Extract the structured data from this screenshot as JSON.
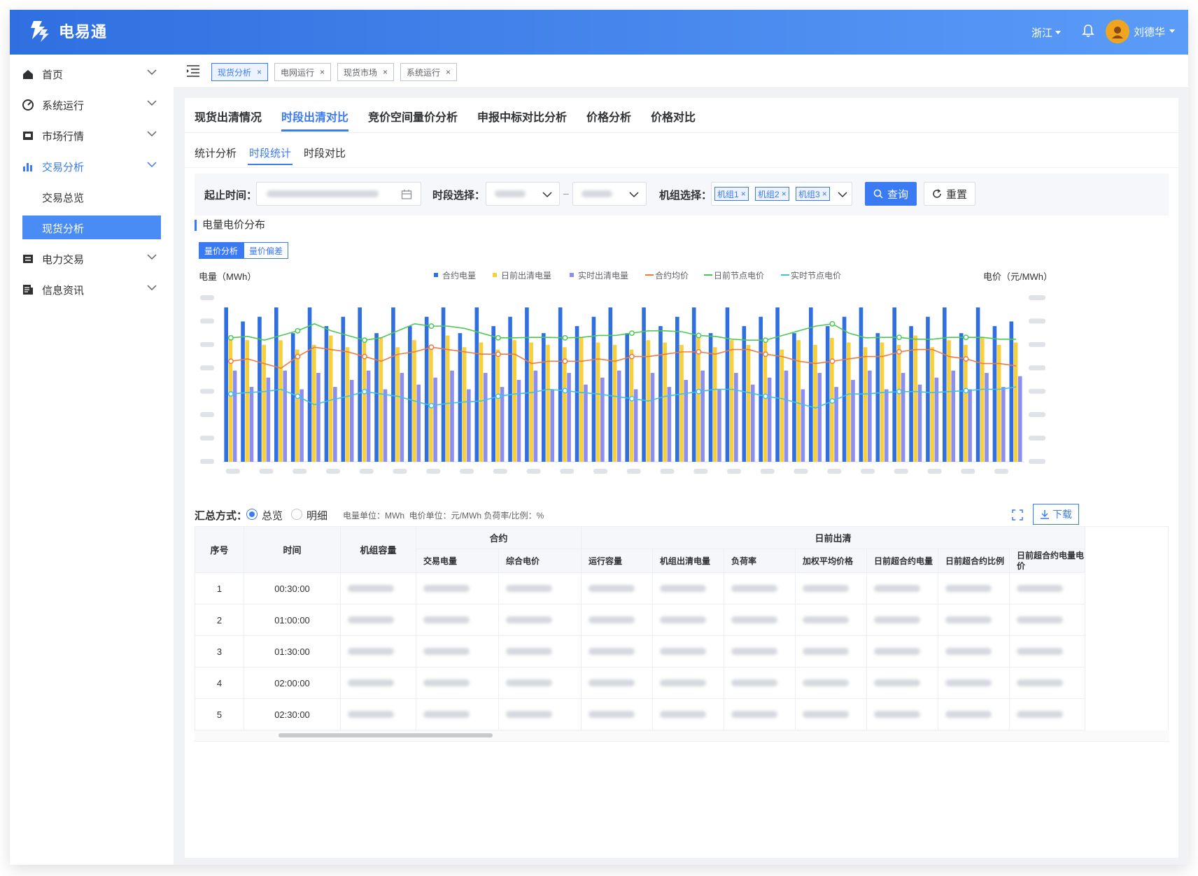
{
  "app": {
    "name": "电易通",
    "region": "浙江",
    "user": "刘德华"
  },
  "sidebar": {
    "items": [
      {
        "label": "首页",
        "icon": "home-icon"
      },
      {
        "label": "系统运行",
        "icon": "dashboard-icon"
      },
      {
        "label": "市场行情",
        "icon": "market-icon"
      },
      {
        "label": "交易分析",
        "icon": "bar-chart-icon"
      },
      {
        "label": "电力交易",
        "icon": "trade-icon"
      },
      {
        "label": "信息资讯",
        "icon": "news-icon"
      }
    ],
    "subitems": [
      {
        "label": "交易总览"
      },
      {
        "label": "现货分析"
      }
    ]
  },
  "tags": [
    {
      "label": "现货分析"
    },
    {
      "label": "电网运行"
    },
    {
      "label": "现货市场"
    },
    {
      "label": "系统运行"
    }
  ],
  "tabs": [
    {
      "label": "现货出清情况"
    },
    {
      "label": "时段出清对比"
    },
    {
      "label": "竞价空间量价分析"
    },
    {
      "label": "申报中标对比分析"
    },
    {
      "label": "价格分析"
    },
    {
      "label": "价格对比"
    }
  ],
  "subtabs": [
    {
      "label": "统计分析"
    },
    {
      "label": "时段统计"
    },
    {
      "label": "时段对比"
    }
  ],
  "filter": {
    "date_label": "起止时间：",
    "period_label": "时段选择：",
    "period_sep": "–",
    "unit_label": "机组选择：",
    "units": [
      "机组1",
      "机组2",
      "机组3"
    ],
    "query_label": "查询",
    "reset_label": "重置"
  },
  "chart_title": "电量电价分布",
  "segments": [
    {
      "label": "量价分析"
    },
    {
      "label": "量价偏差"
    }
  ],
  "chart_data": {
    "type": "bar",
    "ylabel": "电量（MWh）",
    "y2label": "电价（元/MWh）",
    "legend_position": "top",
    "grid": false,
    "series": [
      {
        "name": "合约电量",
        "kind": "bar",
        "color": "#2f6fe0",
        "values": [
          330,
          300,
          310,
          330,
          275,
          330,
          290,
          310,
          330,
          275,
          330,
          290,
          310,
          330,
          275,
          330,
          290,
          310,
          330,
          275,
          330,
          290,
          310,
          330,
          275,
          330,
          290,
          310,
          330,
          275,
          330,
          290,
          310,
          330,
          275,
          330,
          290,
          310,
          330,
          275,
          330,
          290,
          310,
          330,
          275,
          330,
          290,
          300
        ]
      },
      {
        "name": "日前出清电量",
        "kind": "bar",
        "color": "#f7d03c",
        "values": [
          270,
          260,
          250,
          260,
          240,
          250,
          270,
          245,
          255,
          265,
          245,
          260,
          250,
          270,
          245,
          255,
          240,
          260,
          255,
          250,
          245,
          265,
          255,
          250,
          240,
          260,
          255,
          250,
          270,
          245,
          260,
          250,
          255,
          240,
          260,
          250,
          265,
          255,
          245,
          255,
          250,
          270,
          245,
          260,
          250,
          265,
          250,
          255
        ]
      },
      {
        "name": "实时出清电量",
        "kind": "bar",
        "color": "#8d8ff0",
        "values": [
          195,
          160,
          180,
          195,
          155,
          190,
          160,
          175,
          195,
          155,
          190,
          165,
          180,
          195,
          155,
          190,
          160,
          175,
          195,
          155,
          190,
          165,
          180,
          195,
          155,
          190,
          160,
          175,
          195,
          155,
          190,
          165,
          180,
          195,
          155,
          190,
          160,
          175,
          195,
          155,
          190,
          165,
          180,
          195,
          155,
          190,
          160,
          183
        ]
      },
      {
        "name": "合约均价",
        "kind": "line",
        "color": "#f07b3f",
        "values": [
          215,
          220,
          210,
          200,
          225,
          245,
          240,
          235,
          225,
          215,
          230,
          235,
          245,
          240,
          235,
          230,
          230,
          230,
          210,
          215,
          215,
          215,
          220,
          215,
          225,
          225,
          230,
          235,
          235,
          230,
          240,
          240,
          230,
          225,
          215,
          210,
          215,
          220,
          225,
          225,
          235,
          240,
          240,
          225,
          220,
          210,
          210,
          205
        ]
      },
      {
        "name": "日前节点电价",
        "kind": "line",
        "color": "#4cc954",
        "values": [
          265,
          268,
          260,
          270,
          280,
          295,
          280,
          270,
          260,
          265,
          280,
          295,
          290,
          290,
          285,
          275,
          265,
          265,
          266,
          266,
          265,
          266,
          270,
          270,
          275,
          280,
          280,
          278,
          270,
          268,
          262,
          260,
          260,
          270,
          280,
          290,
          295,
          275,
          265,
          266,
          266,
          262,
          262,
          266,
          266,
          266,
          262,
          262
        ]
      },
      {
        "name": "实时节点电价",
        "kind": "line",
        "color": "#3fc1e0",
        "values": [
          145,
          148,
          150,
          155,
          140,
          122,
          132,
          140,
          150,
          145,
          140,
          130,
          120,
          125,
          128,
          130,
          140,
          145,
          148,
          155,
          152,
          148,
          145,
          140,
          135,
          130,
          140,
          145,
          150,
          155,
          155,
          148,
          140,
          135,
          125,
          115,
          130,
          145,
          145,
          148,
          150,
          150,
          148,
          150,
          152,
          155,
          155,
          160
        ]
      }
    ],
    "ylim": [
      0,
      350
    ],
    "y2lim": [
      0,
      350
    ]
  },
  "summary": {
    "label": "汇总方式：",
    "opt1": "总览",
    "opt2": "明细",
    "units": "电量单位：MWh  电价单位：元/MWh 负荷率/比例：%",
    "download_label": "下载"
  },
  "table": {
    "group_contract": "合约",
    "group_dayahead": "日前出清",
    "h_index": "序号",
    "h_time": "时间",
    "h_capacity": "机组容量",
    "sub_headers": [
      "交易电量",
      "综合电价",
      "运行容量",
      "机组出清电量",
      "负荷率",
      "加权平均价格",
      "日前超合约电量",
      "日前超合约比例",
      "日前超合约电量电价"
    ],
    "rows": [
      {
        "idx": "1",
        "time": "00:30:00"
      },
      {
        "idx": "2",
        "time": "01:00:00"
      },
      {
        "idx": "3",
        "time": "01:30:00"
      },
      {
        "idx": "4",
        "time": "02:00:00"
      },
      {
        "idx": "5",
        "time": "02:30:00"
      }
    ]
  }
}
